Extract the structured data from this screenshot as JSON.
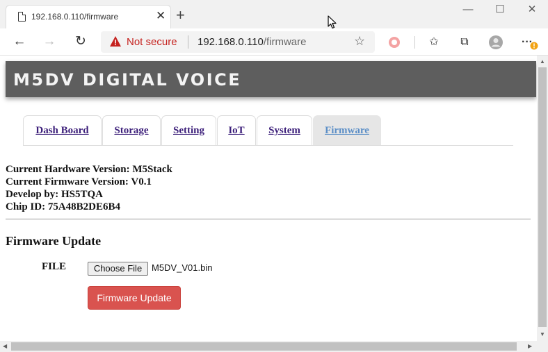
{
  "browser": {
    "tab_title": "192.168.0.110/firmware",
    "tab_close": "✕",
    "new_tab": "+",
    "window_buttons": {
      "minimize": "—",
      "maximize": "☐",
      "close": "✕"
    },
    "nav": {
      "back": "←",
      "forward": "→",
      "reload": "↻"
    },
    "security_text": "Not secure",
    "url_host": "192.168.0.110",
    "url_path": "/firmware",
    "favorite_star": "☆",
    "toolbar_icons": {
      "favorites": "✩",
      "collections": "⧉",
      "more": "···"
    }
  },
  "page": {
    "header_title": "M5DV DIGITAL VOICE",
    "tabs": [
      {
        "label": "Dash Board",
        "active": false
      },
      {
        "label": "Storage",
        "active": false
      },
      {
        "label": "Setting",
        "active": false
      },
      {
        "label": "IoT",
        "active": false
      },
      {
        "label": "System",
        "active": false
      },
      {
        "label": "Firmware",
        "active": true
      }
    ],
    "info": {
      "hardware": "Current Hardware Version: M5Stack",
      "firmware": "Current Firmware Version: V0.1",
      "developer": "Develop by: HS5TQA",
      "chip_id": "Chip ID: 75A48B2DE6B4"
    },
    "update_section": {
      "title": "Firmware Update",
      "file_label": "FILE",
      "choose_button": "Choose File",
      "file_name": "M5DV_V01.bin",
      "update_button": "Firmware Update"
    }
  },
  "colors": {
    "header_bg": "#5e5e5e",
    "active_tab_bg": "#e6e6e6",
    "active_tab_text": "#5c8fc7",
    "link_text": "#3c1f7a",
    "update_button_bg": "#d9534f",
    "not_secure": "#c5221f"
  }
}
